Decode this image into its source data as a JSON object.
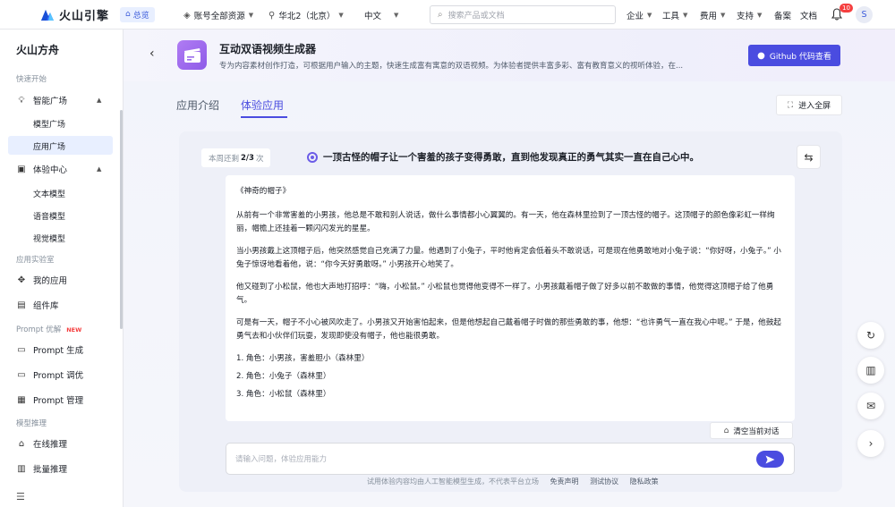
{
  "topbar": {
    "brand": "火山引擎",
    "home": "总览",
    "account": "账号全部资源",
    "region": "华北2（北京）",
    "language": "中文",
    "search_placeholder": "搜索产品或文档",
    "menu": [
      "企业",
      "工具",
      "费用",
      "支持"
    ],
    "filing": "备案",
    "docs": "文档",
    "notification_count": "10",
    "avatar_initial": "S"
  },
  "sidebar": {
    "title": "火山方舟",
    "sec_quick": "快速开始",
    "smart_plaza": "智能广场",
    "model_plaza": "模型广场",
    "app_plaza": "应用广场",
    "experience_center": "体验中心",
    "text_model": "文本模型",
    "voice_model": "语音模型",
    "vision_model": "视觉模型",
    "sec_lab": "应用实验室",
    "my_apps": "我的应用",
    "components": "组件库",
    "sec_prompt": "Prompt 优解",
    "new_tag": "NEW",
    "prompt_gen": "Prompt 生成",
    "prompt_tune": "Prompt 调优",
    "prompt_manage": "Prompt 管理",
    "sec_infer": "模型推理",
    "online_infer": "在线推理",
    "batch_infer": "批量推理"
  },
  "app": {
    "title": "互动双语视频生成器",
    "description": "专为内容素材创作打造，可根据用户输入的主题，快速生成富有寓意的双语视频。为体验者提供丰富多彩、富有教育意义的视听体验，在...",
    "github_button": "Github 代码查看",
    "tab_intro": "应用介绍",
    "tab_try": "体验应用",
    "fullscreen": "进入全屏"
  },
  "chat": {
    "quota_prefix": "本周还剩",
    "quota_value": "2/3",
    "quota_suffix": "次",
    "prompt": "一顶古怪的帽子让一个害羞的孩子变得勇敢，直到他发现真正的勇气其实一直在自己心中。",
    "story_title": "《神奇的帽子》",
    "paragraphs": [
      "从前有一个非常害羞的小男孩，他总是不敢和别人说话，做什么事情都小心翼翼的。有一天，他在森林里捡到了一顶古怪的帽子。这顶帽子的颜色像彩虹一样绚丽，帽檐上还挂着一颗闪闪发光的星星。",
      "当小男孩戴上这顶帽子后，他突然感觉自己充满了力量。他遇到了小兔子，平时他肯定会低着头不敢说话，可是现在他勇敢地对小兔子说：“你好呀，小兔子。” 小兔子惊讶地看着他，说：“你今天好勇敢呀。” 小男孩开心地笑了。",
      "他又碰到了小松鼠，他也大声地打招呼：“嗨，小松鼠。” 小松鼠也觉得他变得不一样了。小男孩戴着帽子做了好多以前不敢做的事情，他觉得这顶帽子给了他勇气。",
      "可是有一天，帽子不小心被风吹走了。小男孩又开始害怕起来，但是他想起自己戴着帽子时做的那些勇敢的事，他想：“也许勇气一直在我心中呢。” 于是，他鼓起勇气去和小伙伴们玩耍，发现即使没有帽子，他也能很勇敢。"
    ],
    "list": [
      "1. 角色：小男孩，害羞胆小（森林里）",
      "2. 角色：小兔子（森林里）",
      "3. 角色：小松鼠（森林里）"
    ],
    "clear_button": "清空当前对话",
    "input_placeholder": "请输入问题，体验应用能力"
  },
  "footer": {
    "disclaimer": "试用体验内容均由人工智能模型生成，不代表平台立场",
    "links": [
      "免责声明",
      "测试协议",
      "隐私政策"
    ]
  },
  "colors": {
    "accent": "#4a4ce0",
    "active_bg": "#e8efff",
    "badge": "#f53f3f"
  }
}
